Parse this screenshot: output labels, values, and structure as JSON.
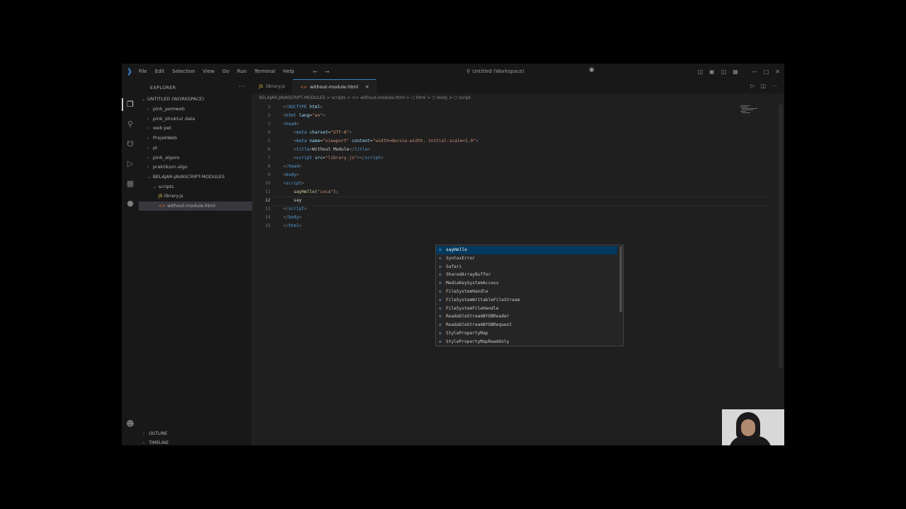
{
  "titlebar": {
    "menu": [
      "File",
      "Edit",
      "Selection",
      "View",
      "Go",
      "Run",
      "Terminal",
      "Help"
    ],
    "search": "Untitled (Workspace)"
  },
  "sidebar": {
    "title": "EXPLORER",
    "workspace": "UNTITLED (WORKSPACE)",
    "items": [
      {
        "label": "pink_pemweb",
        "indent": 1,
        "kind": "folder"
      },
      {
        "label": "pink_struktur data",
        "indent": 1,
        "kind": "folder"
      },
      {
        "label": "web pet",
        "indent": 1,
        "kind": "folder"
      },
      {
        "label": "ProjekWeb",
        "indent": 1,
        "kind": "folder"
      },
      {
        "label": "pl",
        "indent": 1,
        "kind": "folder"
      },
      {
        "label": "pink_algoro",
        "indent": 1,
        "kind": "folder"
      },
      {
        "label": "praktikum algo",
        "indent": 1,
        "kind": "folder"
      },
      {
        "label": "BELAJAR-JAVASCRIPT-MODULES",
        "indent": 1,
        "kind": "folder-open"
      },
      {
        "label": "scripts",
        "indent": 2,
        "kind": "folder-open"
      },
      {
        "label": "library.js",
        "indent": 3,
        "kind": "js"
      },
      {
        "label": "without-module.html",
        "indent": 3,
        "kind": "html"
      }
    ],
    "outline": "OUTLINE",
    "timeline": "TIMELINE"
  },
  "tabs": [
    {
      "label": "library.js",
      "active": false,
      "kind": "js"
    },
    {
      "label": "without-module.html",
      "active": true,
      "kind": "html"
    }
  ],
  "breadcrumb": "BELAJAR-JAVASCRIPT-MODULES > scripts > <> without-module.html > ⬡ html > ⬡ body > ⬡ script",
  "editor": {
    "current_line": 10,
    "lines": [
      {
        "n": "1",
        "tokens": [
          [
            "pl",
            "<!"
          ],
          [
            "tg",
            "DOCTYPE"
          ],
          [
            "tx",
            " "
          ],
          [
            "at",
            "html"
          ],
          [
            "pl",
            ">"
          ]
        ]
      },
      {
        "n": "2",
        "tokens": [
          [
            "pl",
            "<"
          ],
          [
            "tg",
            "html"
          ],
          [
            "tx",
            " "
          ],
          [
            "at",
            "lang"
          ],
          [
            "tx",
            "="
          ],
          [
            "sv",
            "\"en\""
          ],
          [
            "pl",
            ">"
          ]
        ]
      },
      {
        "n": "3",
        "tokens": [
          [
            "pl",
            "<"
          ],
          [
            "tg",
            "head"
          ],
          [
            "pl",
            ">"
          ]
        ]
      },
      {
        "n": "4",
        "tokens": [
          [
            "tx",
            "    "
          ],
          [
            "pl",
            "<"
          ],
          [
            "tg",
            "meta"
          ],
          [
            "tx",
            " "
          ],
          [
            "at",
            "charset"
          ],
          [
            "tx",
            "="
          ],
          [
            "sv",
            "\"UTF-8\""
          ],
          [
            "pl",
            ">"
          ]
        ]
      },
      {
        "n": "5",
        "tokens": [
          [
            "tx",
            "    "
          ],
          [
            "pl",
            "<"
          ],
          [
            "tg",
            "meta"
          ],
          [
            "tx",
            " "
          ],
          [
            "at",
            "name"
          ],
          [
            "tx",
            "="
          ],
          [
            "sv",
            "\"viewport\""
          ],
          [
            "tx",
            " "
          ],
          [
            "at",
            "content"
          ],
          [
            "tx",
            "="
          ],
          [
            "sv",
            "\"width=device-width, initial-scale=1.0\""
          ],
          [
            "pl",
            ">"
          ]
        ]
      },
      {
        "n": "6",
        "tokens": [
          [
            "tx",
            "    "
          ],
          [
            "pl",
            "<"
          ],
          [
            "tg",
            "title"
          ],
          [
            "pl",
            ">"
          ],
          [
            "tx",
            "Without Module"
          ],
          [
            "pl",
            "</"
          ],
          [
            "tg",
            "title"
          ],
          [
            "pl",
            ">"
          ]
        ]
      },
      {
        "n": "7",
        "tokens": [
          [
            "tx",
            "    "
          ],
          [
            "pl",
            "<"
          ],
          [
            "tg",
            "script"
          ],
          [
            "tx",
            " "
          ],
          [
            "at",
            "src"
          ],
          [
            "tx",
            "="
          ],
          [
            "sv",
            "\"library.js\""
          ],
          [
            "pl",
            "></"
          ],
          [
            "tg",
            "script"
          ],
          [
            "pl",
            ">"
          ]
        ]
      },
      {
        "n": "8",
        "tokens": [
          [
            "pl",
            "</"
          ],
          [
            "tg",
            "head"
          ],
          [
            "pl",
            ">"
          ]
        ]
      },
      {
        "n": "9",
        "tokens": [
          [
            "pl",
            "<"
          ],
          [
            "tg",
            "body"
          ],
          [
            "pl",
            ">"
          ]
        ]
      },
      {
        "n": "10",
        "tokens": [
          [
            "pl",
            "<"
          ],
          [
            "tg",
            "script"
          ],
          [
            "pl",
            ">"
          ]
        ]
      },
      {
        "n": "11",
        "tokens": [
          [
            "tx",
            "    "
          ],
          [
            "fn",
            "sayHello"
          ],
          [
            "tx",
            "("
          ],
          [
            "sv",
            "\"coca\""
          ],
          [
            "tx",
            ");"
          ]
        ]
      },
      {
        "n": "12",
        "tokens": [
          [
            "tx",
            "    "
          ],
          [
            "tx",
            "say"
          ]
        ]
      },
      {
        "n": "13",
        "tokens": [
          [
            "pl",
            "</"
          ],
          [
            "tg",
            "script"
          ],
          [
            "pl",
            ">"
          ]
        ]
      },
      {
        "n": "14",
        "tokens": [
          [
            "pl",
            "</"
          ],
          [
            "tg",
            "body"
          ],
          [
            "pl",
            ">"
          ]
        ]
      },
      {
        "n": "15",
        "tokens": [
          [
            "pl",
            "</"
          ],
          [
            "tg",
            "html"
          ],
          [
            "pl",
            ">"
          ]
        ]
      }
    ]
  },
  "suggest": {
    "items": [
      "sayHello",
      "SyntaxError",
      "Safari",
      "SharedArrayBuffer",
      "MediaKeySystemAccess",
      "FileSystemHandle",
      "FileSystemWritableFileStream",
      "FileSystemFileHandle",
      "ReadableStreamBYOBReader",
      "ReadableStreamBYOBRequest",
      "StylePropertyMap",
      "StylePropertyMapReadOnly"
    ],
    "selected": 0
  }
}
